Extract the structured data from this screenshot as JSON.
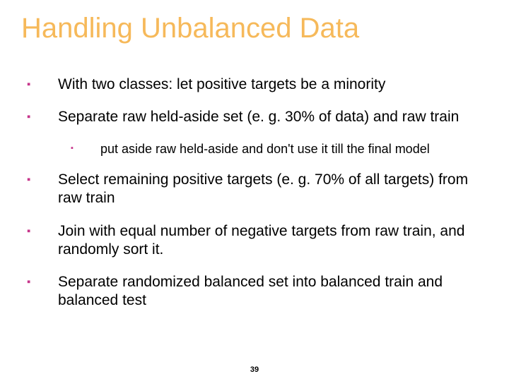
{
  "title": "Handling Unbalanced Data",
  "bullets": {
    "b1": "With two classes: let positive targets be a minority",
    "b2": "Separate raw held-aside set (e. g. 30% of data) and raw train",
    "b2a": "put aside raw held-aside and don't use it till the final model",
    "b3": "Select remaining positive targets  (e. g. 70% of all targets) from raw train",
    "b4": "Join with equal number of negative targets from raw train, and randomly sort it.",
    "b5": "Separate randomized balanced set into balanced train and balanced test"
  },
  "pagenum": "39",
  "bullet_glyph": "▪"
}
